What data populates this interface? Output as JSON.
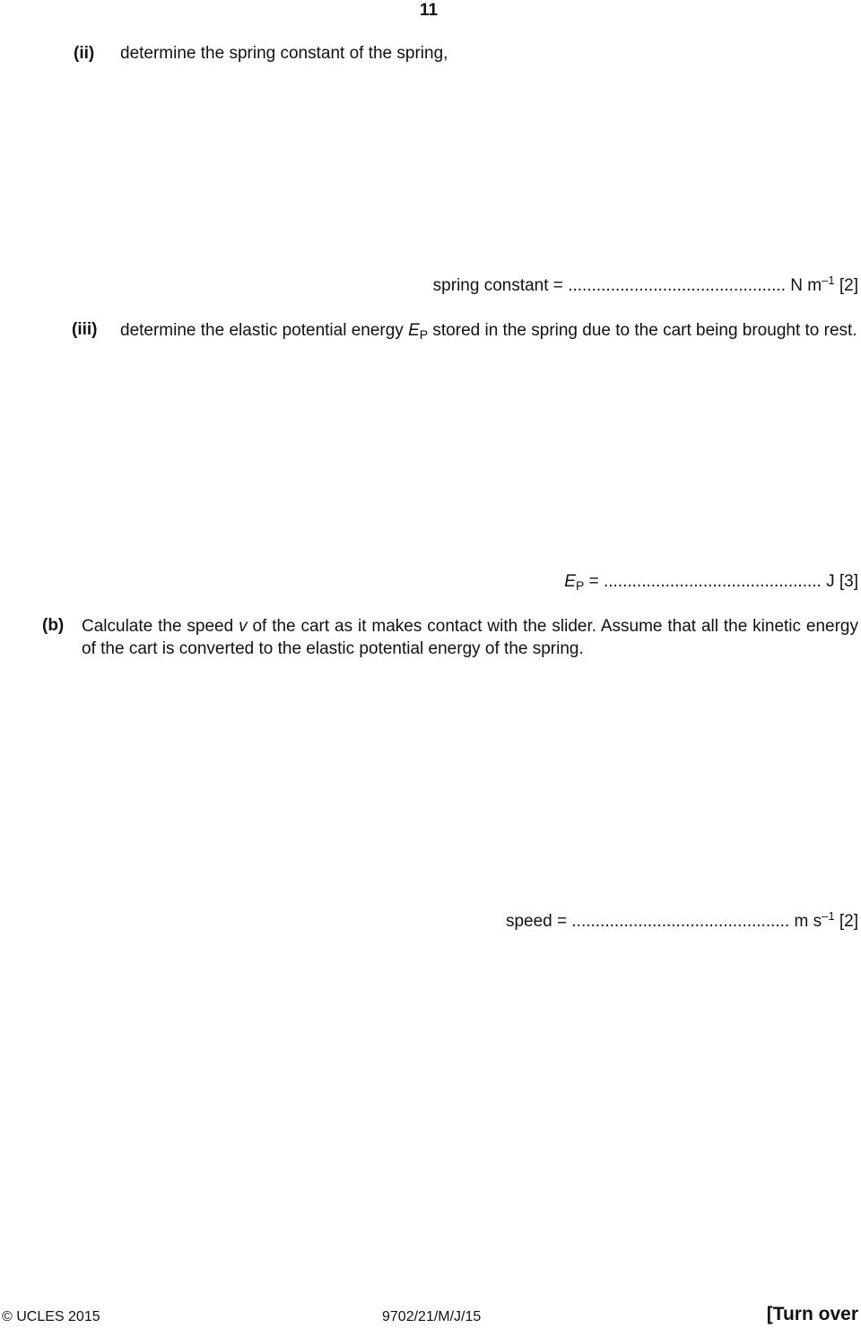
{
  "page_number": "11",
  "q_ii": {
    "label": "(ii)",
    "text": "determine the spring constant of the spring,"
  },
  "answer_ii": {
    "prefix": "spring constant =",
    "dots": "..............................................",
    "unit": "N m",
    "unit_exp": "–1",
    "marks": "[2]"
  },
  "q_iii": {
    "label": "(iii)",
    "text_a": "determine the elastic potential energy",
    "sym": "E",
    "sym_sub": "P",
    "text_b": "stored in the spring due to the cart being brought to rest."
  },
  "answer_iii": {
    "sym": "E",
    "sym_sub": "P",
    "eq": "=",
    "dots": "..............................................",
    "unit": "J",
    "marks": "[3]"
  },
  "q_b": {
    "label": "(b)",
    "text_a": "Calculate the speed",
    "sym": "v",
    "text_b": "of the cart as it makes contact with the slider. Assume that all the kinetic energy of the cart is converted to the elastic potential energy of the spring."
  },
  "answer_b": {
    "prefix": "speed =",
    "dots": "..............................................",
    "unit": "m s",
    "unit_exp": "–1",
    "marks": "[2]"
  },
  "footer": {
    "copyright": "© UCLES 2015",
    "code": "9702/21/M/J/15",
    "turn_over": "[Turn over"
  }
}
